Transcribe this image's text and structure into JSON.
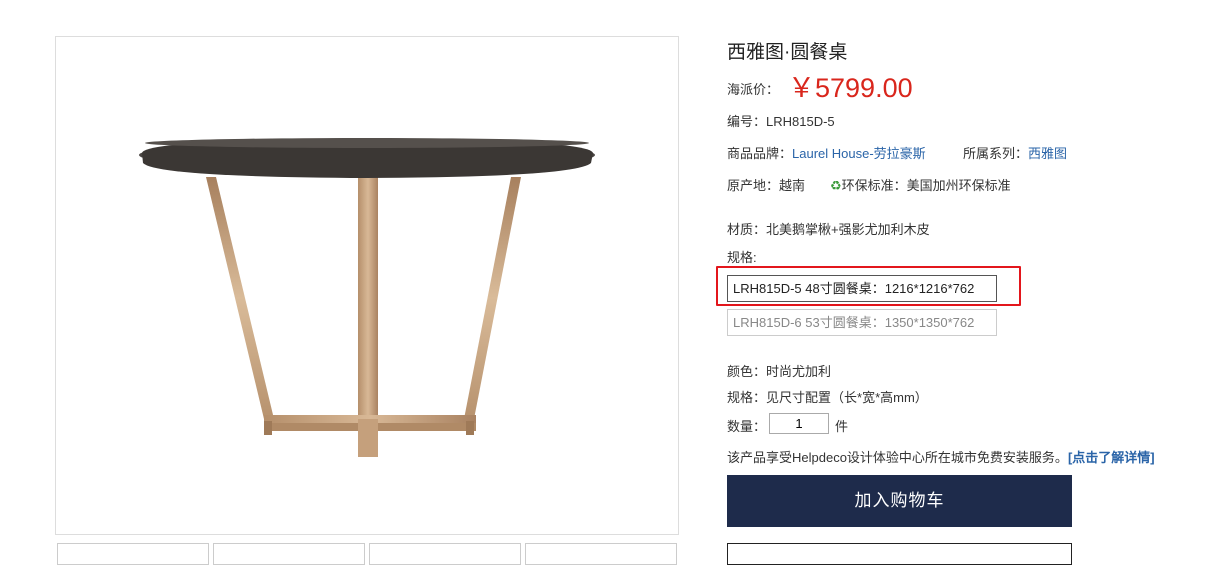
{
  "product": {
    "title": "西雅图·圆餐桌",
    "price_label": "海派价：",
    "price": "￥5799.00",
    "sku_label": "编号：",
    "sku": "LRH815D-5",
    "brand_label": "商品品牌：",
    "brand": "Laurel House-劳拉豪斯",
    "series_label": "所属系列：",
    "series": "西雅图",
    "origin_label": "原产地：",
    "origin": "越南",
    "eco_symbol": "♻",
    "eco_label": "环保标准：",
    "eco": "美国加州环保标准",
    "material_label": "材质：",
    "material": "北美鹅掌楸+强影尤加利木皮",
    "spec_label": "规格:",
    "spec_options": [
      "LRH815D-5 48寸圆餐桌：1216*1216*762",
      "LRH815D-6 53寸圆餐桌：1350*1350*762"
    ],
    "color_label": "颜色：",
    "color": "时尚尤加利",
    "size_label": "规格：",
    "size": "见尺寸配置（长*宽*高mm）",
    "qty_label": "数量：",
    "qty": "1",
    "qty_unit": "件",
    "service_text": "该产品享受Helpdeco设计体验中心所在城市免费安装服务。",
    "service_link": "[点击了解详情]",
    "cart_button": "加入购物车"
  },
  "colors": {
    "price": "#d9261c",
    "link": "#2a64a8",
    "cart_bg": "#1e2b4b",
    "highlight": "#e3161c"
  }
}
